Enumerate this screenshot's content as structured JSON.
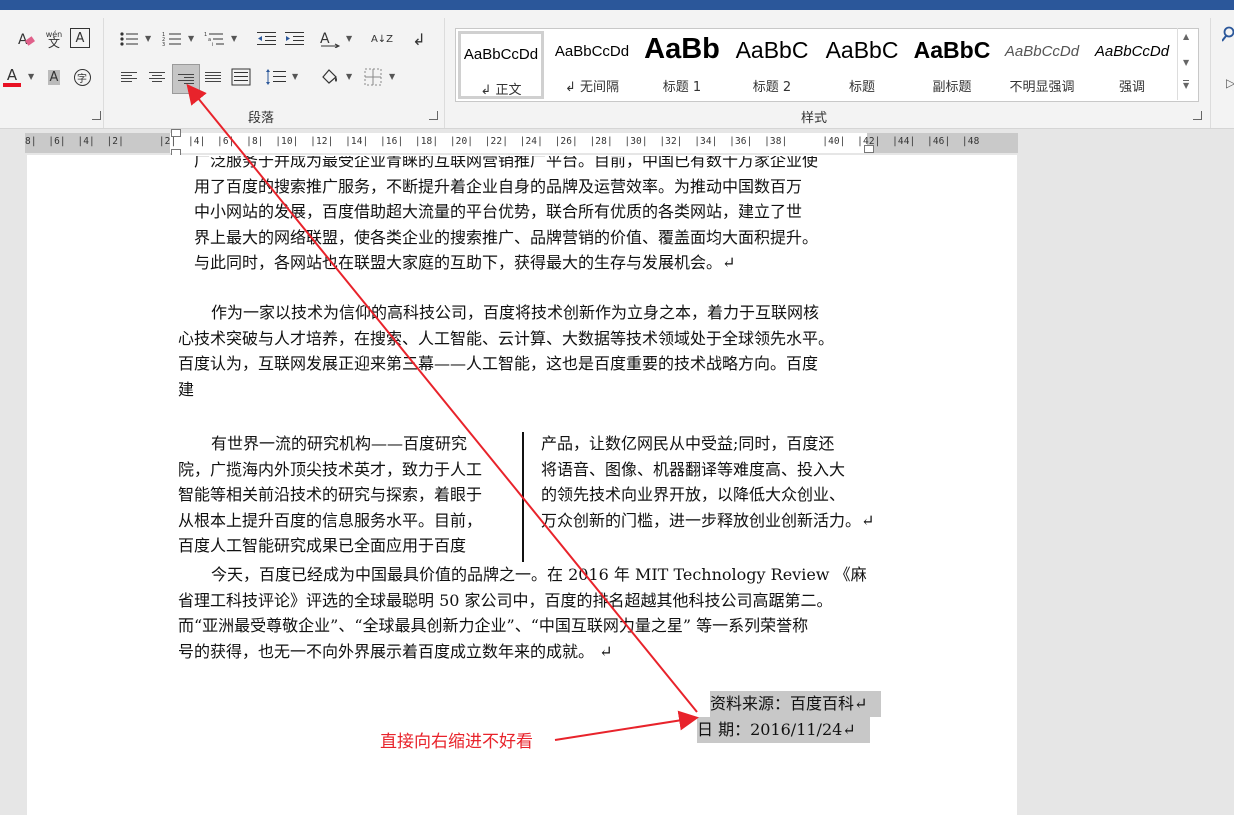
{
  "ribbon": {
    "paragraph_group_label": "段落",
    "styles_group_label": "样式",
    "font_buttons": {
      "wen_label": "wén",
      "wen_char": "文",
      "boxed_a": "A",
      "font_color": "A",
      "shade_a": "A",
      "circled": "字"
    },
    "sort_label": "A↓Z",
    "styles": [
      {
        "sample": "AaBbCcDd",
        "name": "↲ 正文"
      },
      {
        "sample": "AaBbCcDd",
        "name": "↲ 无间隔"
      },
      {
        "sample": "AaBb",
        "name": "标题 1"
      },
      {
        "sample": "AaBbC",
        "name": "标题 2"
      },
      {
        "sample": "AaBbC",
        "name": "标题"
      },
      {
        "sample": "AaBbC",
        "name": "副标题"
      },
      {
        "sample": "AaBbCcDd",
        "name": "不明显强调"
      },
      {
        "sample": "AaBbCcDd",
        "name": "强调"
      }
    ]
  },
  "ruler": {
    "text": "8|  |6|  |4|  |2|      |2|  |4|  |6|  |8|  |10|  |12|  |14|  |16|  |18|  |20|  |22|  |24|  |26|  |28|  |30|  |32|  |34|  |36|  |38|      |40|  |42|  |44|  |46|  |48"
  },
  "document": {
    "p1_lines": [
      "广泛服务于并成为最受企业青睐的互联网营销推广平台。目前，中国已有数十万家企业使",
      "用了百度的搜索推广服务，不断提升着企业自身的品牌及运营效率。为推动中国数百万",
      "中小网站的发展，百度借助超大流量的平台优势，联合所有优质的各类网站，建立了世",
      "界上最大的网络联盟，使各类企业的搜索推广、品牌营销的价值、覆盖面均大面积提升。",
      "与此同时，各网站也在联盟大家庭的互助下，获得最大的生存与发展机会。↵"
    ],
    "p2_lines": [
      "作为一家以技术为信仰的高科技公司，百度将技术创新作为立身之本，着力于互联网核",
      "心技术突破与人才培养，在搜索、人工智能、云计算、大数据等技术领域处于全球领先水平。",
      "百度认为，互联网发展正迎来第三幕——人工智能，这也是百度重要的技术战略方向。百度",
      "建"
    ],
    "col_left_lines": [
      "有世界一流的研究机构——百度研究",
      "院，广揽海内外顶尖技术英才，致力于人工",
      "智能等相关前沿技术的研究与探索，着眼于",
      "从根本上提升百度的信息服务水平。目前，",
      "百度人工智能研究成果已全面应用于百度"
    ],
    "col_right_lines": [
      "产品，让数亿网民从中受益;同时，百度还",
      "将语音、图像、机器翻译等难度高、投入大",
      "的领先技术向业界开放，以降低大众创业、",
      "万众创新的门槛，进一步释放创业创新活力。↵"
    ],
    "p3_lines": [
      "今天，百度已经成为中国最具价值的品牌之一。在 2016 年 MIT Technology Review 《麻",
      "省理工科技评论》评选的全球最聪明 50 家公司中，百度的排名超越其他科技公司高踞第二。",
      "而“亚洲最受尊敬企业”、“全球最具创新力企业”、“中国互联网力量之星” 等一系列荣誉称",
      "号的获得，也无一不向外界展示着百度成立数年来的成就。  ↵"
    ],
    "source_line": "资料来源：百度百科↵",
    "date_line": "日      期：2016/11/24↵"
  },
  "annotation": {
    "text": "直接向右缩进不好看",
    "color": "#e8232b"
  },
  "colors": {
    "titlebar": "#2b579a",
    "highlight": "#c8c8c8",
    "font_color_bar": "#e81123"
  }
}
